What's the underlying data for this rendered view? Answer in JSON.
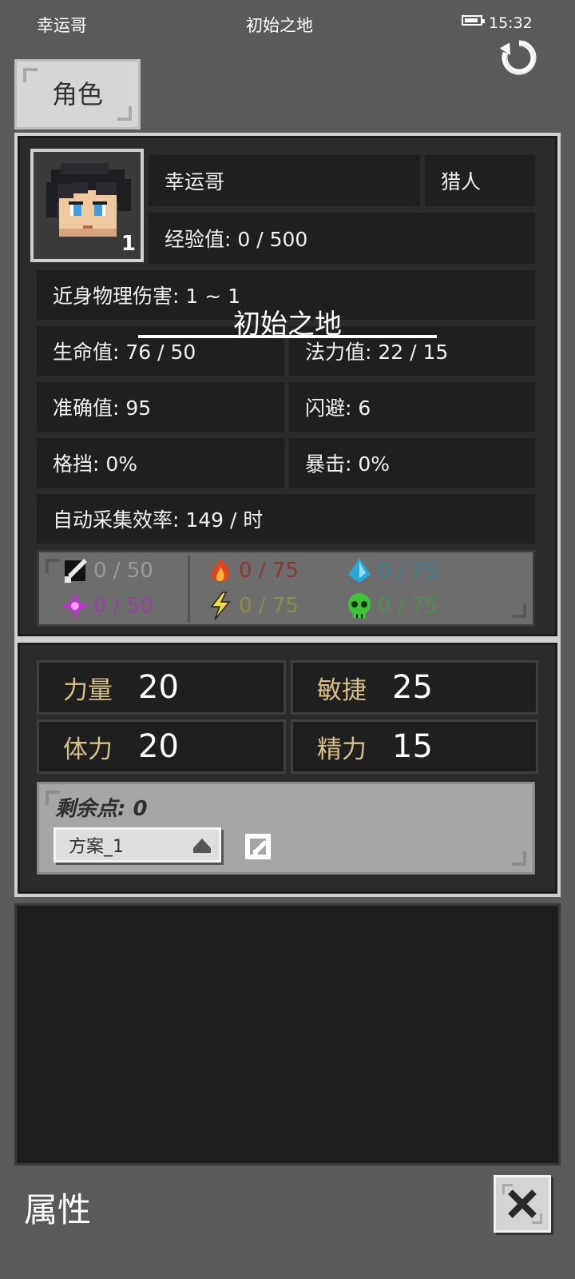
{
  "status_bar": {
    "player_name": "幸运哥",
    "location": "初始之地",
    "time": "15:32",
    "battery_level": 0.9
  },
  "tab": {
    "label": "角色"
  },
  "character": {
    "name": "幸运哥",
    "class": "猎人",
    "level": "1",
    "exp": "经验值: 0 / 500",
    "melee_damage": "近身物理伤害: 1 ~ 1",
    "overlay_location": "初始之地",
    "hp": "生命值: 76 / 50",
    "mp": "法力值: 22 / 15",
    "accuracy": "准确值: 95",
    "dodge": "闪避: 6",
    "block": "格挡: 0%",
    "crit": "暴击: 0%",
    "gather_rate": "自动采集效率: 149 / 时"
  },
  "resistances": [
    {
      "icon": "sword-icon",
      "value": "0 / 50",
      "color": "#9a9a9a"
    },
    {
      "icon": "fire-icon",
      "value": "0 / 75",
      "color": "#8a3a33"
    },
    {
      "icon": "water-drop-icon",
      "value": "0 / 75",
      "color": "#3a7f8f"
    },
    {
      "icon": "magic-star-icon",
      "value": "0 / 50",
      "color": "#9a3fa5"
    },
    {
      "icon": "lightning-icon",
      "value": "0 / 75",
      "color": "#8e8a4a"
    },
    {
      "icon": "poison-skull-icon",
      "value": "0 / 75",
      "color": "#4f8f4a"
    }
  ],
  "attributes": [
    {
      "label": "力量",
      "value": "20"
    },
    {
      "label": "敏捷",
      "value": "25"
    },
    {
      "label": "体力",
      "value": "20"
    },
    {
      "label": "精力",
      "value": "15"
    }
  ],
  "points": {
    "remaining": "剩余点: 0",
    "scheme": "方案_1"
  },
  "bottom": {
    "title": "属性"
  }
}
